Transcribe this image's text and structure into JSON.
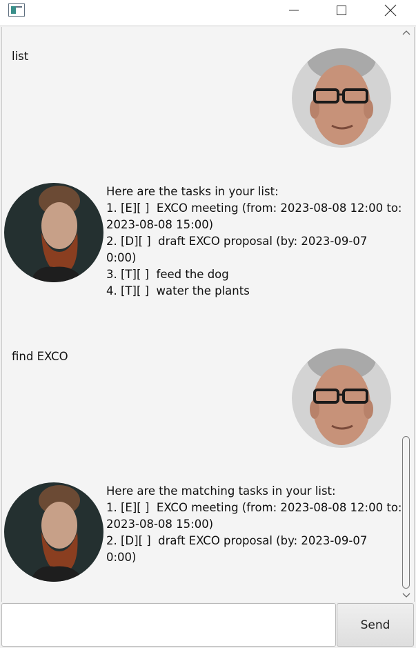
{
  "window": {
    "icons": {
      "app": "app-window-icon",
      "minimize": "minimize-icon",
      "maximize": "maximize-icon",
      "close": "close-icon"
    }
  },
  "chat": {
    "messages": [
      {
        "sender": "user",
        "text": "list",
        "avatar": "user-avatar"
      },
      {
        "sender": "duke",
        "text": "Here are the tasks in your list:\n1. [E][ ]  EXCO meeting (from: 2023-08-08 12:00 to:\n2023-08-08 15:00)\n2. [D][ ]  draft EXCO proposal (by: 2023-09-07\n0:00)\n3. [T][ ]  feed the dog\n4. [T][ ]  water the plants",
        "avatar": "duke-avatar"
      },
      {
        "sender": "user",
        "text": "find EXCO",
        "avatar": "user-avatar"
      },
      {
        "sender": "duke",
        "text": "Here are the matching tasks in your list:\n1. [E][ ]  EXCO meeting (from: 2023-08-08 12:00 to:\n2023-08-08 15:00)\n2. [D][ ]  draft EXCO proposal (by: 2023-09-07\n0:00)",
        "avatar": "duke-avatar"
      }
    ]
  },
  "input": {
    "value": "",
    "placeholder": ""
  },
  "send_button": {
    "label": "Send"
  }
}
